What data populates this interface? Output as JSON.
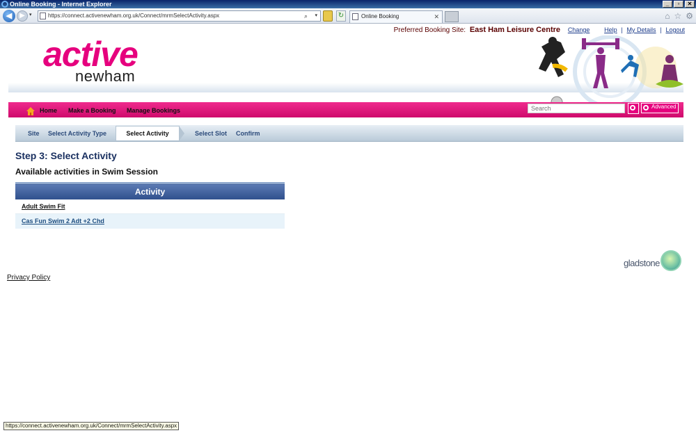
{
  "window": {
    "title": "Online Booking - Internet Explorer",
    "controls": [
      "_",
      "▫",
      "✕"
    ]
  },
  "browser": {
    "back_glyph": "◀",
    "fwd_glyph": "▶",
    "dropdown_glyph": "▾",
    "url": "https://connect.activenewham.org.uk/Connect/mrmSelectActivity.aspx",
    "search_glyph": "⌕",
    "tab_title": "Online Booking",
    "tab_close": "✕",
    "refresh_glyph": "↻",
    "toolbar_icons": [
      "⌂",
      "☆",
      "⚙"
    ]
  },
  "header": {
    "site_label": "Preferred Booking Site:",
    "site_name": "East Ham Leisure Centre",
    "change": "Change",
    "help": "Help",
    "my_details": "My Details",
    "logout": "Logout",
    "separator": "|"
  },
  "logo": {
    "line1": "active",
    "line2": "newham"
  },
  "nav": {
    "home": "Home",
    "make_booking": "Make a Booking",
    "manage_bookings": "Manage Bookings",
    "search_placeholder": "Search",
    "advanced": "Advanced"
  },
  "steps": {
    "site": "Site",
    "select_activity_type": "Select Activity Type",
    "select_activity": "Select Activity",
    "select_slot": "Select Slot",
    "confirm": "Confirm"
  },
  "main": {
    "step_title": "Step 3: Select Activity",
    "subtitle": "Available activities in Swim Session",
    "table_header": "Activity",
    "rows": [
      "Adult Swim Fit",
      "Cas Fun Swim 2 Adt +2 Chd"
    ]
  },
  "footer": {
    "vendor": "gladstone",
    "privacy": "Privacy Policy"
  },
  "status": {
    "text": "https://connect.activenewham.org.uk/Connect/mrmSelectActivity.aspx"
  },
  "colors": {
    "brand_pink": "#e6007e",
    "header_blue": "#2f4f8c",
    "row_alt": "#e8f3fa"
  }
}
